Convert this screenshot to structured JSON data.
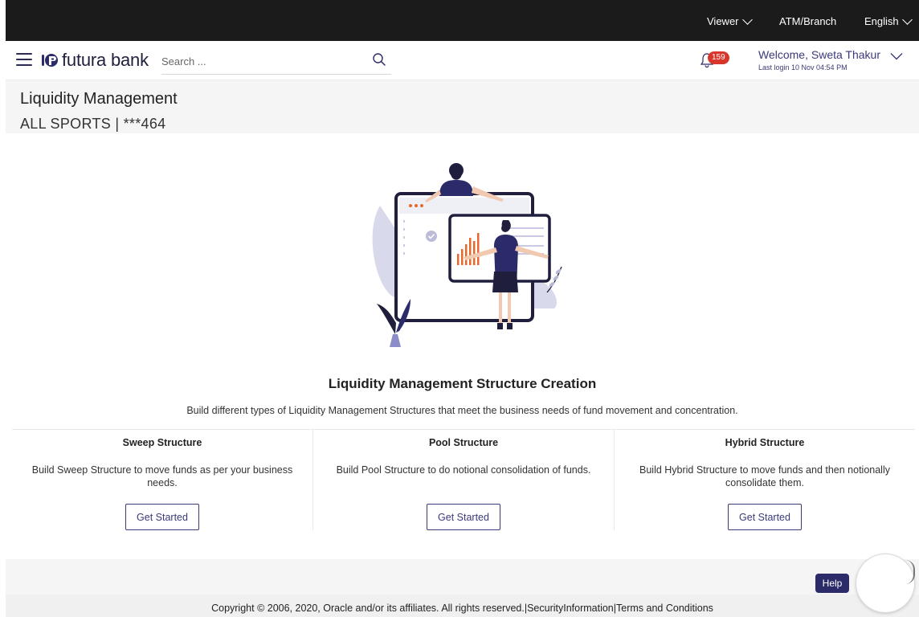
{
  "topbar": {
    "viewer_label": "Viewer",
    "atm_branch_label": "ATM/Branch",
    "language_label": "English"
  },
  "header": {
    "brand": "futura bank",
    "search_placeholder": "Search ...",
    "notification_count": "159",
    "welcome_text": "Welcome, Sweta Thakur",
    "last_login": "Last login 10 Nov 04:54 PM"
  },
  "page": {
    "title": "Liquidity Management",
    "account": "ALL SPORTS | ***464"
  },
  "main": {
    "heading": "Liquidity Management Structure Creation",
    "description": "Build different types of Liquidity Management Structures that meet the business needs of fund movement and concentration.",
    "options": [
      {
        "title": "Sweep Structure",
        "description": "Build Sweep Structure to move funds as per your business needs.",
        "button": "Get Started"
      },
      {
        "title": "Pool Structure",
        "description": "Build Pool Structure to do notional consolidation of funds.",
        "button": "Get Started"
      },
      {
        "title": "Hybrid Structure",
        "description": "Build Hybrid Structure to move funds and then notionally consolidate them.",
        "button": "Get Started"
      }
    ]
  },
  "help_label": "Help",
  "footer": {
    "text": "Copyright © 2006, 2020, Oracle and/or its affiliates. All rights reserved.|SecurityInformation|Terms and Conditions"
  },
  "colors": {
    "topbar_bg": "#1b1b1b",
    "brand_primary": "#2b2b6a",
    "notification_badge": "#d9362b",
    "illustration_accent": "#e8672a"
  },
  "icons": [
    "hamburger-icon",
    "futura-logo-icon",
    "search-icon",
    "bell-icon",
    "chevron-down-icon"
  ]
}
